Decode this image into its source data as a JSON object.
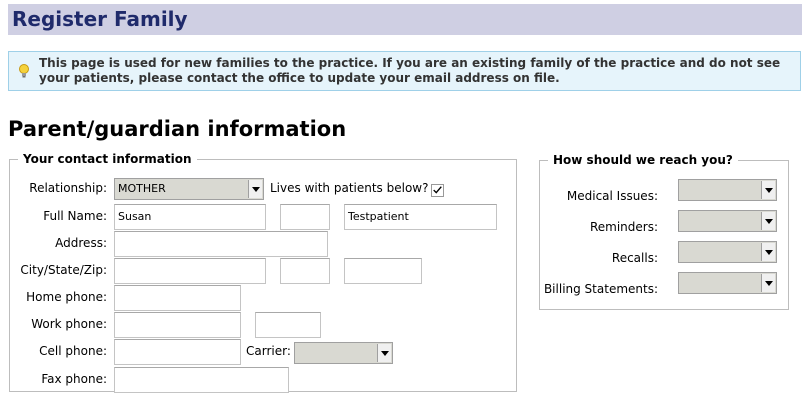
{
  "header": {
    "title": "Register Family"
  },
  "notice": {
    "icon": "lightbulb-icon",
    "text": "This page is used for new families to the practice. If you are an existing family of the practice and do not see your patients, please contact the office to update your email address on file."
  },
  "section_title": "Parent/guardian information",
  "contact": {
    "legend": "Your contact information",
    "relationship_label": "Relationship:",
    "relationship_value": "MOTHER",
    "lives_with_label": "Lives with patients below?",
    "lives_with_checked": true,
    "full_name_label": "Full Name:",
    "first_name": "Susan",
    "middle_name": "",
    "last_name": "Testpatient",
    "address_label": "Address:",
    "address": "",
    "city_state_zip_label": "City/State/Zip:",
    "city": "",
    "state": "",
    "zip": "",
    "home_phone_label": "Home phone:",
    "home_phone": "",
    "work_phone_label": "Work phone:",
    "work_phone": "",
    "work_ext": "",
    "cell_phone_label": "Cell phone:",
    "cell_phone": "",
    "carrier_label": "Carrier:",
    "carrier_value": "",
    "fax_phone_label": "Fax phone:",
    "fax_phone": ""
  },
  "reach": {
    "legend": "How should we reach you?",
    "medical_label": "Medical Issues:",
    "reminders_label": "Reminders:",
    "recalls_label": "Recalls:",
    "billing_label": "Billing Statements:",
    "medical_value": "",
    "reminders_value": "",
    "recalls_value": "",
    "billing_value": ""
  }
}
